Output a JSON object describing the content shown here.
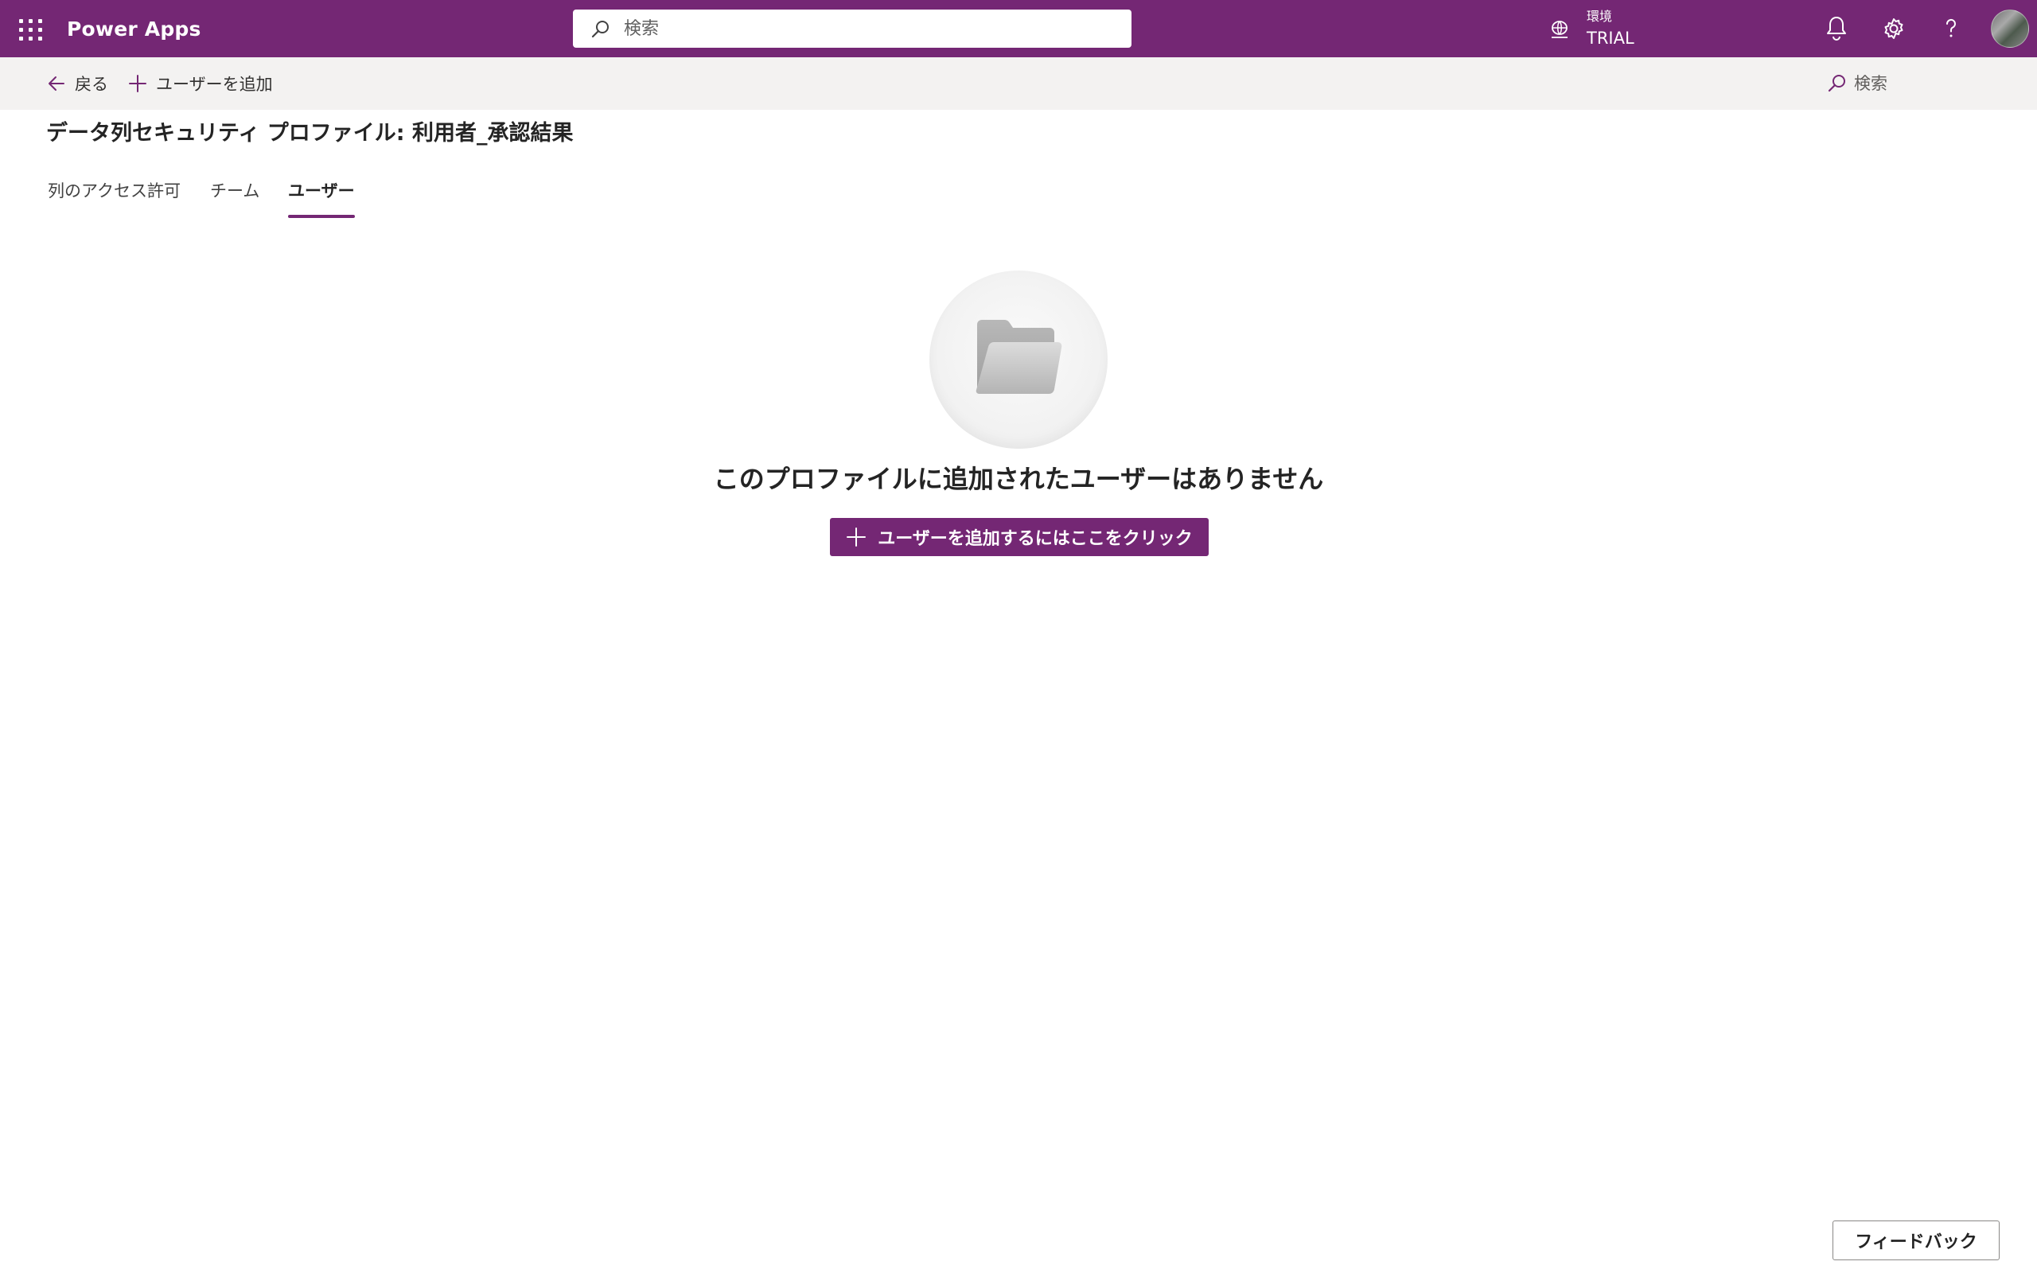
{
  "appbar": {
    "app_name": "Power Apps",
    "waffle_icon": "app-launcher-icon",
    "search_placeholder": "検索",
    "environment": {
      "label": "環境",
      "name": "TRIAL",
      "icon": "environment-globe-icon"
    },
    "icons": [
      "bell-icon",
      "gear-icon",
      "help-icon"
    ],
    "brand_color": "#742774"
  },
  "commandbar": {
    "back_label": "戻る",
    "add_user_label": "ユーザーを追加",
    "search_placeholder": "検索"
  },
  "page": {
    "title": "データ列セキュリティ プロファイル: 利用者_承認結果",
    "tabs": [
      {
        "label": "列のアクセス許可",
        "active": false
      },
      {
        "label": "チーム",
        "active": false
      },
      {
        "label": "ユーザー",
        "active": true
      }
    ]
  },
  "empty_state": {
    "icon": "folder-icon",
    "message": "このプロファイルに追加されたユーザーはありません",
    "action_label": "ユーザーを追加するにはここをクリック"
  },
  "feedback": {
    "label": "フィードバック"
  }
}
